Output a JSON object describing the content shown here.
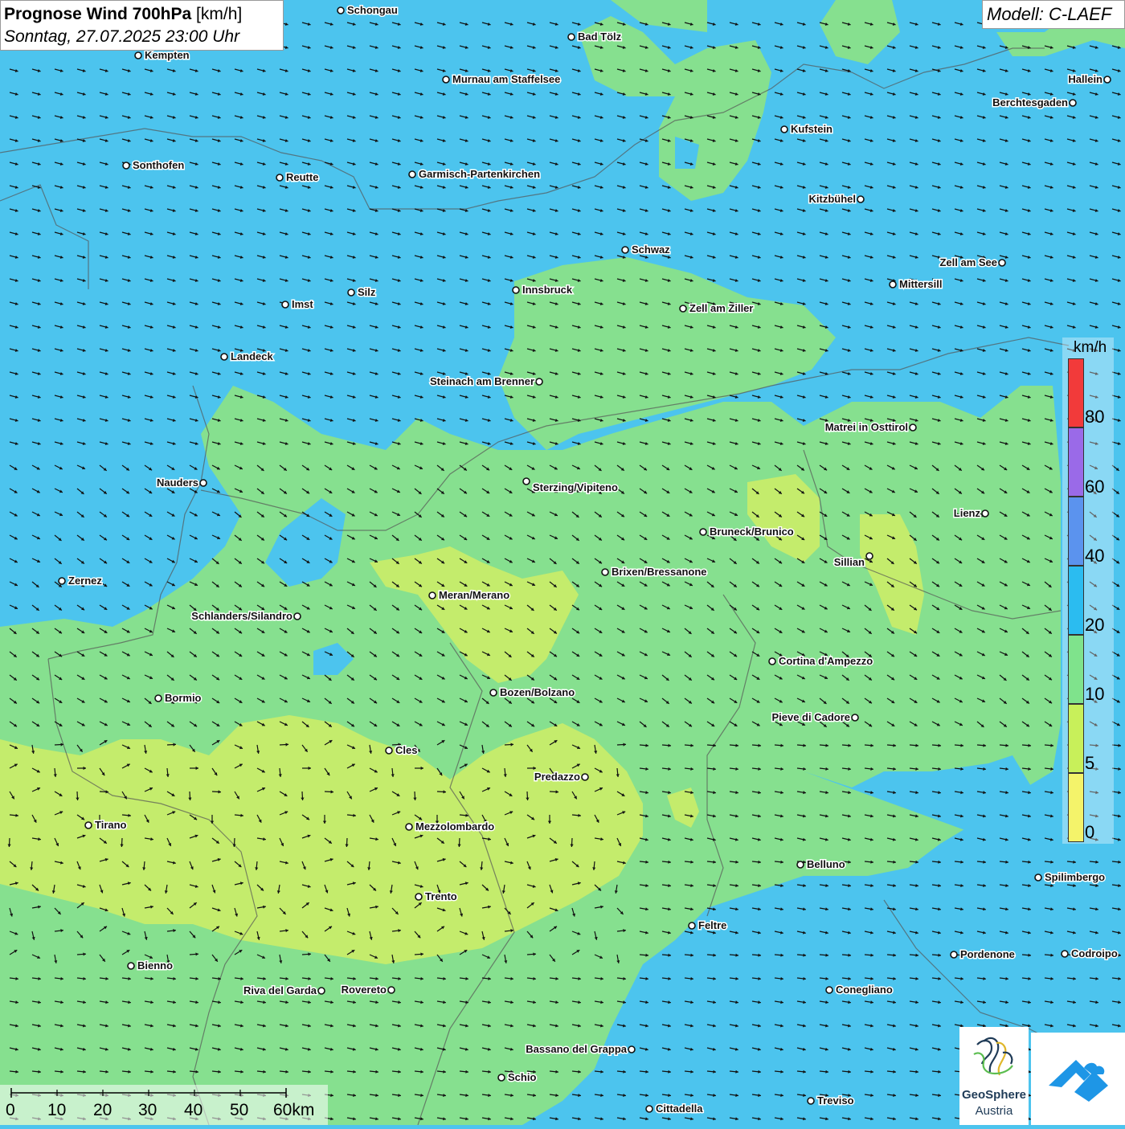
{
  "header": {
    "title": "Prognose Wind 700hPa",
    "unit": "[km/h]",
    "datetime": "Sonntag, 27.07.2025 23:00 Uhr"
  },
  "model": "Modell: C-LAEF",
  "legend": {
    "unit": "km/h",
    "labels": [
      "80",
      "60",
      "40",
      "20",
      "10",
      "5",
      "0"
    ],
    "colors": [
      "#f23a3a",
      "#9a6ae8",
      "#5b93ee",
      "#2bbcf0",
      "#7fe38c",
      "#c8f05a",
      "#f4f36a"
    ]
  },
  "scalebar": {
    "labels": [
      "0",
      "10",
      "20",
      "30",
      "40",
      "50",
      "60km"
    ]
  },
  "cities": [
    {
      "name": "Schongau"
    },
    {
      "name": "Bad Tölz"
    },
    {
      "name": "Kempten"
    },
    {
      "name": "Murnau am Staffelsee"
    },
    {
      "name": "Hallein"
    },
    {
      "name": "Berchtesgaden"
    },
    {
      "name": "Kufstein"
    },
    {
      "name": "Sonthofen"
    },
    {
      "name": "Reutte"
    },
    {
      "name": "Garmisch-Partenkirchen"
    },
    {
      "name": "Kitzbühel"
    },
    {
      "name": "Schwaz"
    },
    {
      "name": "Zell am See"
    },
    {
      "name": "Mittersill"
    },
    {
      "name": "Innsbruck"
    },
    {
      "name": "Silz"
    },
    {
      "name": "Imst"
    },
    {
      "name": "Zell am Ziller"
    },
    {
      "name": "Landeck"
    },
    {
      "name": "Steinach am Brenner"
    },
    {
      "name": "Matrei in Osttirol"
    },
    {
      "name": "Nauders"
    },
    {
      "name": "Sterzing/Vipiteno"
    },
    {
      "name": "Lienz"
    },
    {
      "name": "Bruneck/Brunico"
    },
    {
      "name": "Sillian"
    },
    {
      "name": "Zernez"
    },
    {
      "name": "Brixen/Bressanone"
    },
    {
      "name": "Meran/Merano"
    },
    {
      "name": "Schlanders/Silandro"
    },
    {
      "name": "Cortina d'Ampezzo"
    },
    {
      "name": "Bozen/Bolzano"
    },
    {
      "name": "Bormio"
    },
    {
      "name": "Pieve di Cadore"
    },
    {
      "name": "Cles"
    },
    {
      "name": "Predazzo"
    },
    {
      "name": "Tirano"
    },
    {
      "name": "Mezzolombardo"
    },
    {
      "name": "Belluno"
    },
    {
      "name": "Spilimbergo"
    },
    {
      "name": "Trento"
    },
    {
      "name": "Feltre"
    },
    {
      "name": "Bienno"
    },
    {
      "name": "Pordenone"
    },
    {
      "name": "Codroipo"
    },
    {
      "name": "Riva del Garda"
    },
    {
      "name": "Rovereto"
    },
    {
      "name": "Conegliano"
    },
    {
      "name": "Bassano del Grappa"
    },
    {
      "name": "Schio"
    },
    {
      "name": "Treviso"
    },
    {
      "name": "Cittadella"
    }
  ],
  "logos": {
    "geosphere_name": "GeoSphere",
    "geosphere_sub": "Austria",
    "app_icon": "geosphere-app-icon"
  }
}
